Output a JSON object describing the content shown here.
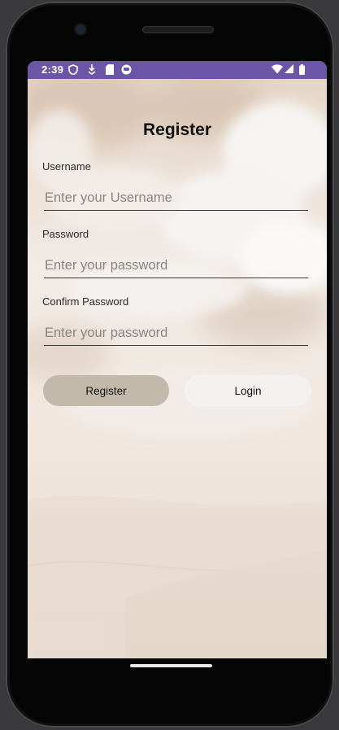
{
  "status_bar": {
    "time": "2:39",
    "left_icons": [
      "shield-icon",
      "download-icon",
      "sim-card-icon",
      "android-icon"
    ],
    "right_icons": [
      "wifi-icon",
      "signal-icon",
      "battery-icon"
    ],
    "color": "#6a55a7"
  },
  "form": {
    "title": "Register",
    "username": {
      "label": "Username",
      "placeholder": "Enter your Username",
      "value": ""
    },
    "password": {
      "label": "Password",
      "placeholder": "Enter your password",
      "value": ""
    },
    "confirm_password": {
      "label": "Confirm Password",
      "placeholder": "Enter your password",
      "value": ""
    }
  },
  "actions": {
    "register_label": "Register",
    "login_label": "Login"
  },
  "colors": {
    "register_button": "#c2b9ab",
    "login_button": "#f4f2f0"
  }
}
